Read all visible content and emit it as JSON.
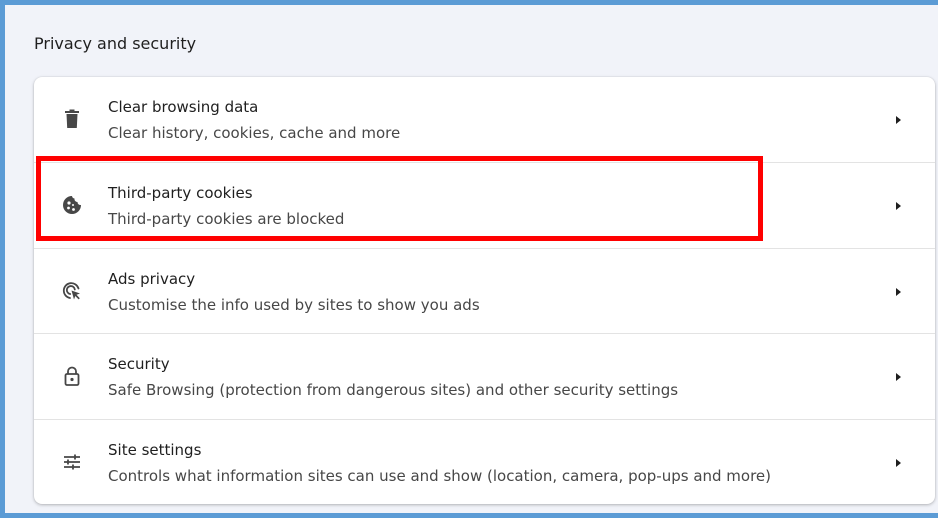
{
  "section": {
    "title": "Privacy and security"
  },
  "items": [
    {
      "title": "Clear browsing data",
      "subtitle": "Clear history, cookies, cache and more",
      "icon": "trash-icon"
    },
    {
      "title": "Third-party cookies",
      "subtitle": "Third-party cookies are blocked",
      "icon": "cookie-icon"
    },
    {
      "title": "Ads privacy",
      "subtitle": "Customise the info used by sites to show you ads",
      "icon": "ads-privacy-icon"
    },
    {
      "title": "Security",
      "subtitle": "Safe Browsing (protection from dangerous sites) and other security settings",
      "icon": "lock-icon"
    },
    {
      "title": "Site settings",
      "subtitle": "Controls what information sites can use and show (location, camera, pop-ups and more)",
      "icon": "tune-icon"
    }
  ],
  "colors": {
    "frame_border": "#5b9bd5",
    "highlight": "#ff0000",
    "background": "#f1f3f9"
  }
}
